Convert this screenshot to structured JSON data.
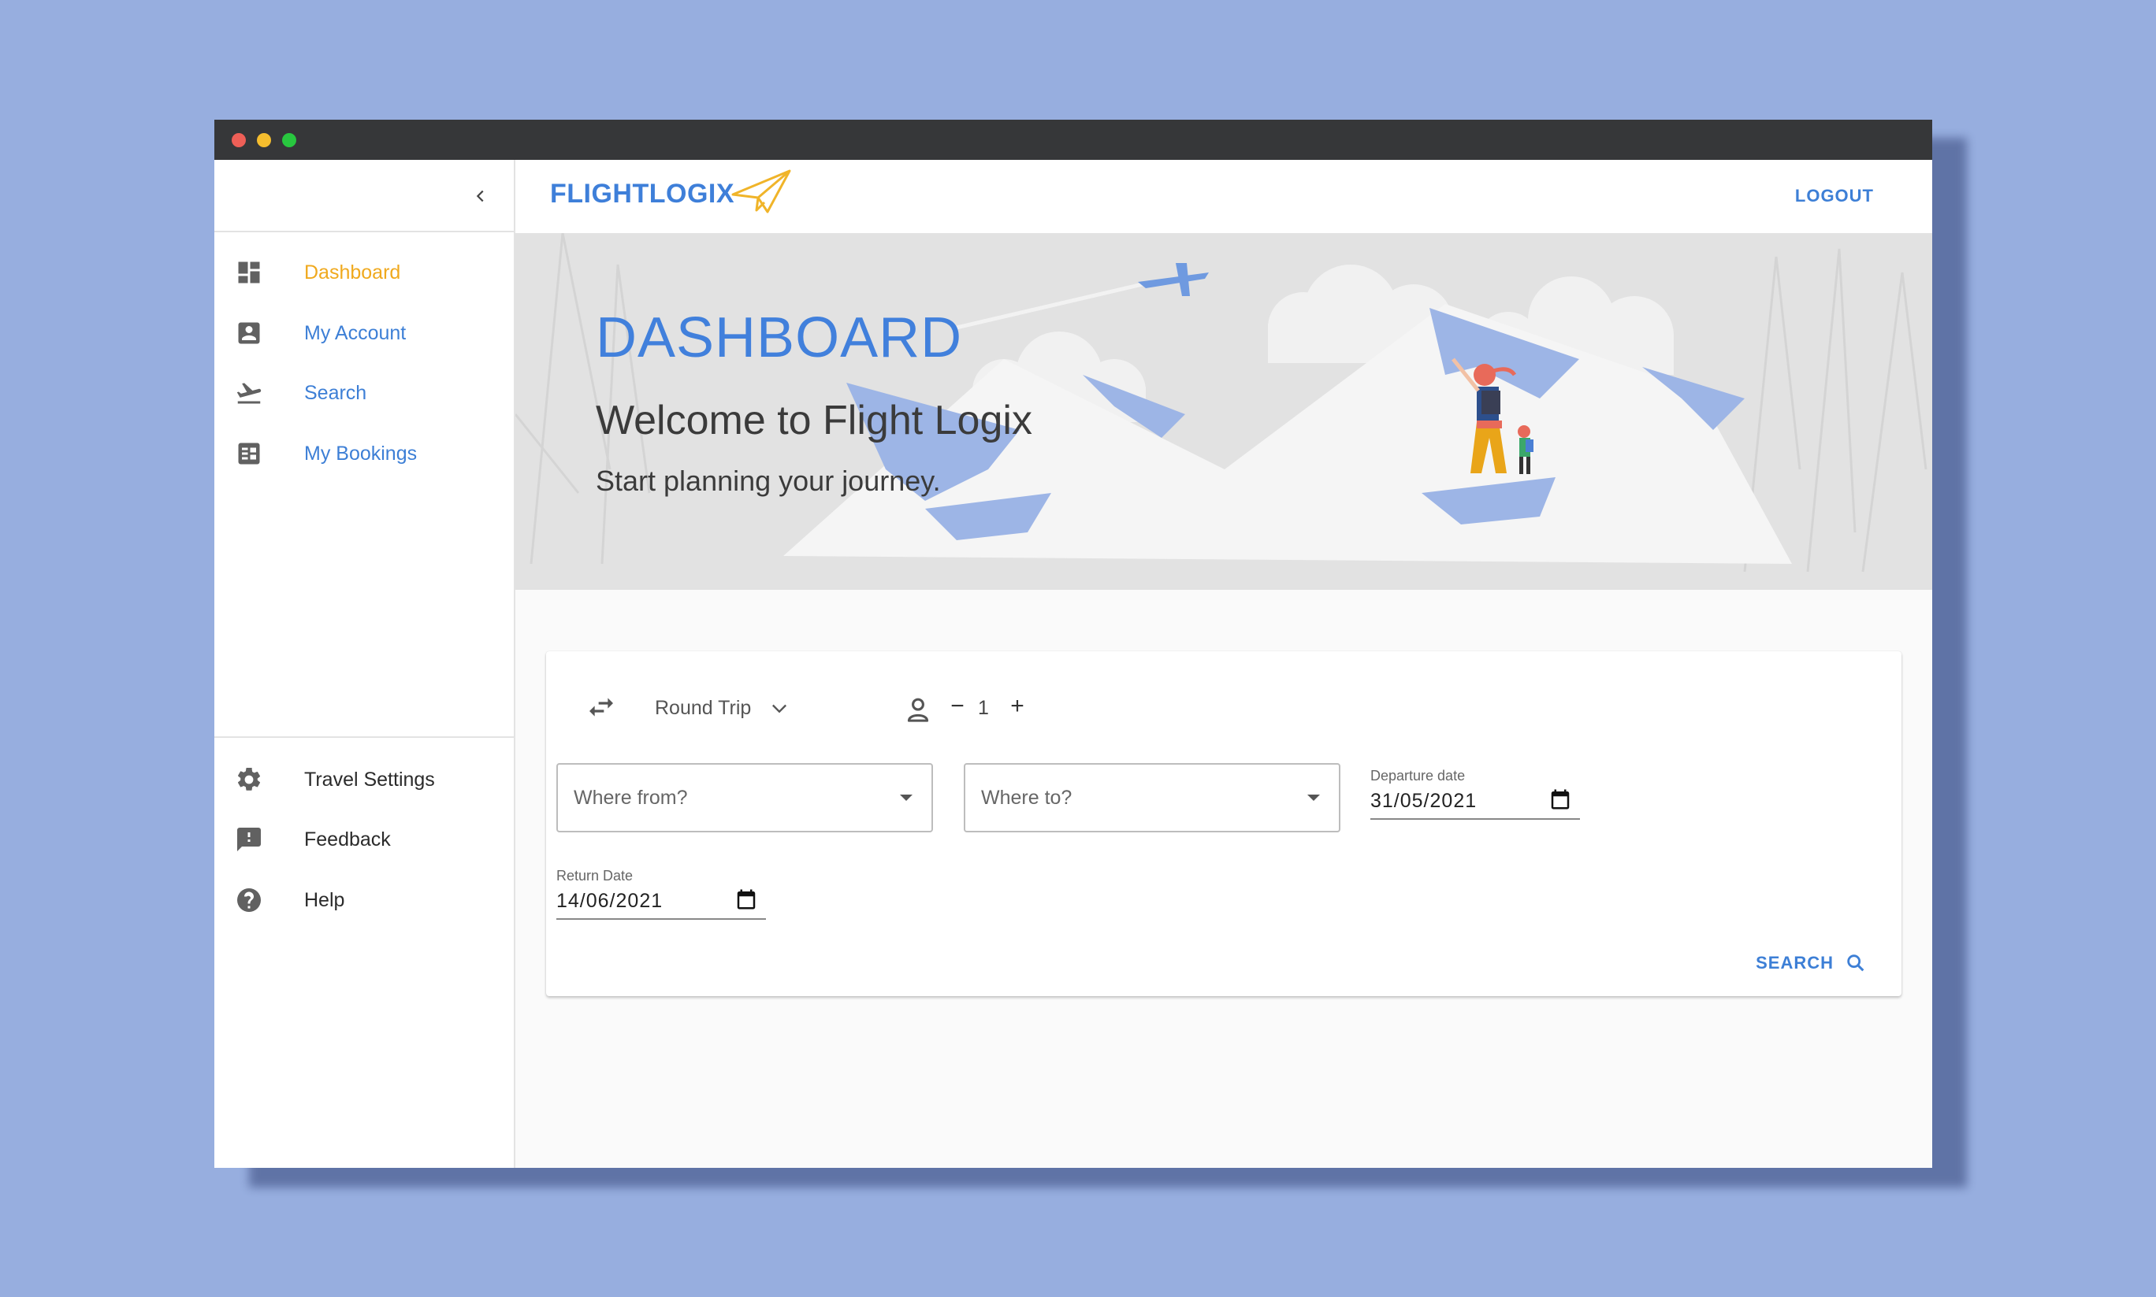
{
  "app": {
    "brand": "FLIGHTLOGIX",
    "logout_label": "LOGOUT",
    "accent_color": "#3e7fd9",
    "active_color": "#f0a91e"
  },
  "sidebar": {
    "items": [
      {
        "label": "Dashboard",
        "icon": "dashboard-icon"
      },
      {
        "label": "My Account",
        "icon": "account-box-icon"
      },
      {
        "label": "Search",
        "icon": "flight-takeoff-icon"
      },
      {
        "label": "My Bookings",
        "icon": "bookings-list-icon"
      }
    ],
    "secondary": [
      {
        "label": "Travel Settings",
        "icon": "gear-icon"
      },
      {
        "label": "Feedback",
        "icon": "feedback-icon"
      },
      {
        "label": "Help",
        "icon": "help-icon"
      }
    ]
  },
  "hero": {
    "title": "DASHBOARD",
    "subtitle": "Welcome to Flight Logix",
    "text": "Start planning your journey."
  },
  "search": {
    "trip_type": "Round Trip",
    "passenger_count": "1",
    "from_placeholder": "Where from?",
    "to_placeholder": "Where to?",
    "departure_label": "Departure date",
    "departure_value": "31/05/2021",
    "return_label": "Return Date",
    "return_value": "14/06/2021",
    "search_label": "SEARCH"
  }
}
